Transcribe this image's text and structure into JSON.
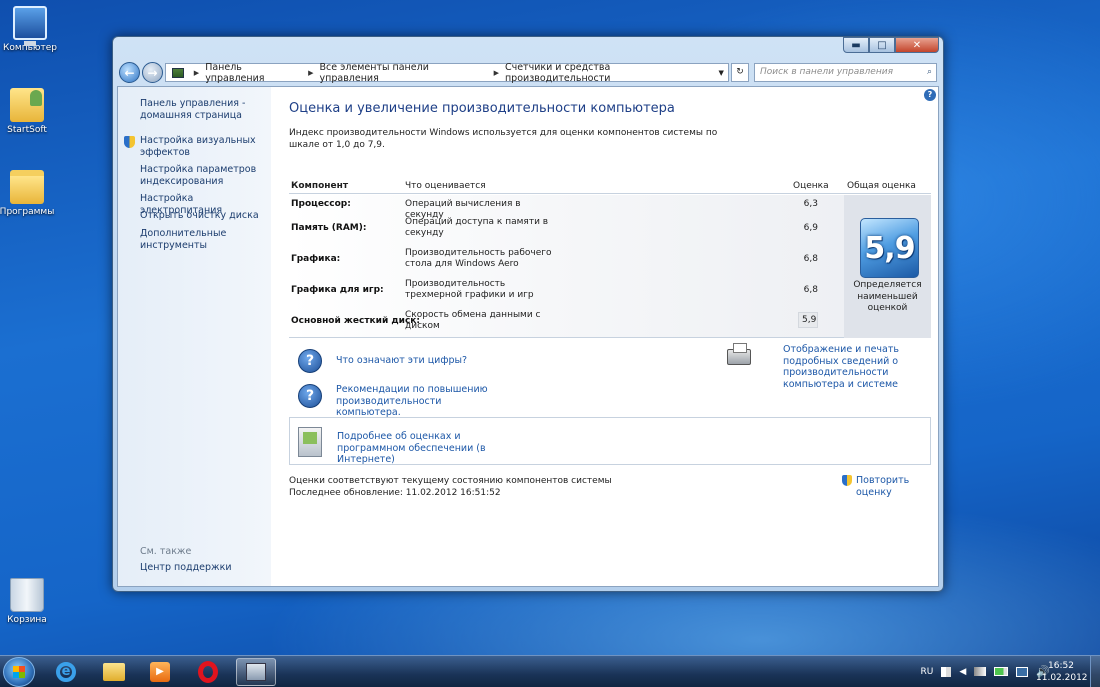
{
  "desktop": {
    "icons": [
      {
        "label": "Компьютер"
      },
      {
        "label": "StartSoft"
      },
      {
        "label": "Программы"
      },
      {
        "label": "Корзина"
      }
    ]
  },
  "window": {
    "breadcrumb": [
      "Панель управления",
      "Все элементы панели управления",
      "Счетчики и средства производительности"
    ],
    "search_placeholder": "Поиск в панели управления",
    "buttons": {
      "minimize": "▬",
      "maximize": "□",
      "close": "✕"
    }
  },
  "sidebar": {
    "links": [
      "Панель управления - домашняя страница",
      "Настройка визуальных эффектов",
      "Настройка параметров индексирования",
      "Настройка электропитания",
      "Открыть очистку диска",
      "Дополнительные инструменты"
    ],
    "see_also_title": "См. также",
    "see_also_links": [
      "Центр поддержки"
    ]
  },
  "main": {
    "title": "Оценка и увеличение производительности компьютера",
    "intro": "Индекс производительности Windows используется для оценки компонентов системы по шкале от 1,0 до 7,9.",
    "table": {
      "headers": {
        "component": "Компонент",
        "what": "Что оценивается",
        "score": "Оценка",
        "overall": "Общая оценка"
      },
      "rows": [
        {
          "component": "Процессор:",
          "what": "Операций вычисления в секунду",
          "score": "6,3"
        },
        {
          "component": "Память (RAM):",
          "what": "Операций доступа к памяти в секунду",
          "score": "6,9"
        },
        {
          "component": "Графика:",
          "what": "Производительность рабочего стола для Windows Aero",
          "score": "6,8"
        },
        {
          "component": "Графика для игр:",
          "what": "Производительность трехмерной графики и игр",
          "score": "6,8"
        },
        {
          "component": "Основной жесткий диск:",
          "what": "Скорость обмена данными с диском",
          "score": "5,9"
        }
      ],
      "overall_score": "5,9",
      "overall_note": "Определяется наименьшей оценкой"
    },
    "links": {
      "what_numbers": "Что означают эти цифры?",
      "recommendations": "Рекомендации по повышению производительности компьютера.",
      "print": "Отображение и печать подробных сведений о производительности компьютера и системе",
      "online": "Подробнее об оценках и программном обеспечении (в Интернете)",
      "rerun": "Повторить оценку"
    },
    "status_line1": "Оценки соответствуют текущему состоянию компонентов системы",
    "status_line2": "Последнее обновление: 11.02.2012 16:51:52"
  },
  "taskbar": {
    "language": "RU",
    "time": "16:52",
    "date": "11.02.2012"
  },
  "colors": {
    "link": "#1c57a7",
    "title": "#1e3f87",
    "accent_blue": "#2f6cb7"
  }
}
